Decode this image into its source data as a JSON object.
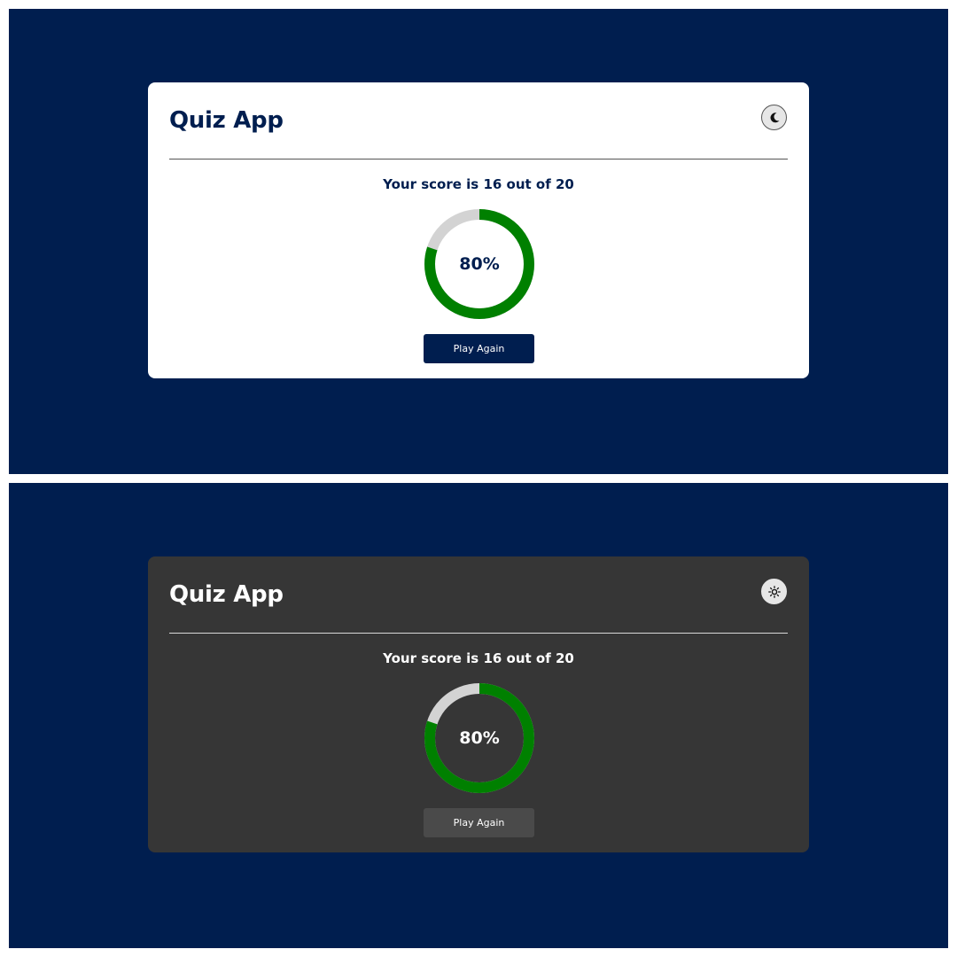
{
  "colors": {
    "background": "#001e4f",
    "light_card": "#ffffff",
    "dark_card": "#363636",
    "progress": "#008000",
    "progress_track": "#d3d3d3",
    "button_light": "#001e4f",
    "button_dark": "#4a4a4a"
  },
  "light_view": {
    "title": "Quiz App",
    "theme_toggle_icon": "moon-icon",
    "score_text": "Your score is 16 out of 20",
    "percent_label": "80%",
    "progress_fraction": 0.8,
    "button_label": "Play Again"
  },
  "dark_view": {
    "title": "Quiz App",
    "theme_toggle_icon": "sun-icon",
    "score_text": "Your score is 16 out of 20",
    "percent_label": "80%",
    "progress_fraction": 0.8,
    "button_label": "Play Again"
  }
}
